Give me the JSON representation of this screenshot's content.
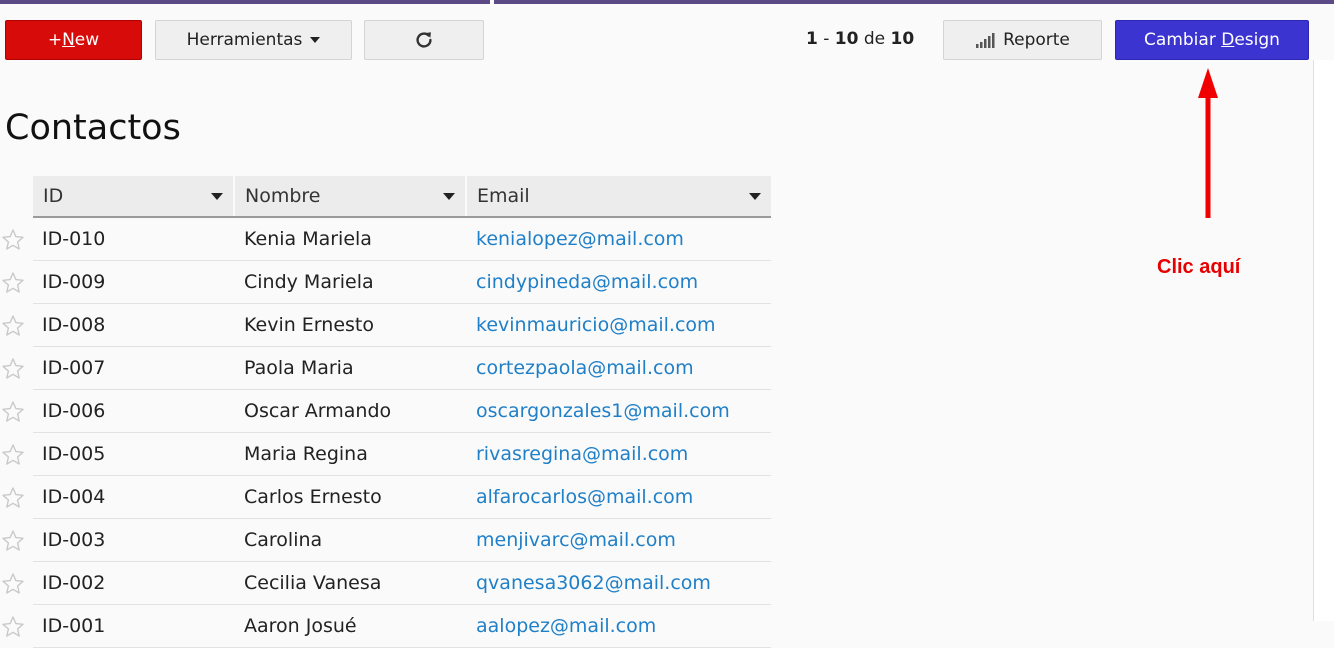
{
  "toolbar": {
    "new_prefix": "+",
    "new_underlined": "N",
    "new_rest": "ew",
    "tools_label": "Herramientas",
    "report_label": "Reporte",
    "design_prefix": "Cambiar ",
    "design_underlined": "D",
    "design_rest": "esign"
  },
  "pager": {
    "from": "1",
    "sep": "-",
    "to": "10",
    "of": "de",
    "total": "10"
  },
  "page_title": "Contactos",
  "table": {
    "columns": [
      "ID",
      "Nombre",
      "Email"
    ],
    "rows": [
      {
        "id": "ID-010",
        "nombre": "Kenia Mariela",
        "email": "kenialopez@mail.com"
      },
      {
        "id": "ID-009",
        "nombre": "Cindy Mariela",
        "email": "cindypineda@mail.com"
      },
      {
        "id": "ID-008",
        "nombre": "Kevin Ernesto",
        "email": "kevinmauricio@mail.com"
      },
      {
        "id": "ID-007",
        "nombre": "Paola Maria",
        "email": "cortezpaola@mail.com"
      },
      {
        "id": "ID-006",
        "nombre": "Oscar Armando",
        "email": "oscargonzales1@mail.com"
      },
      {
        "id": "ID-005",
        "nombre": "Maria Regina",
        "email": "rivasregina@mail.com"
      },
      {
        "id": "ID-004",
        "nombre": "Carlos Ernesto",
        "email": "alfarocarlos@mail.com"
      },
      {
        "id": "ID-003",
        "nombre": "Carolina",
        "email": "menjivarc@mail.com"
      },
      {
        "id": "ID-002",
        "nombre": "Cecilia Vanesa",
        "email": "qvanesa3062@mail.com"
      },
      {
        "id": "ID-001",
        "nombre": "Aaron Josué",
        "email": "aalopez@mail.com"
      }
    ]
  },
  "annotation": {
    "text": "Clic aquí"
  },
  "colors": {
    "new_button": "#d80b0b",
    "design_button": "#3b34d0",
    "email_link": "#1f7fc7",
    "annotation_red": "#e60000"
  },
  "icons": [
    "refresh-icon",
    "bar-chart-icon",
    "star-icon",
    "dropdown-caret-icon",
    "arrow-up-icon"
  ]
}
